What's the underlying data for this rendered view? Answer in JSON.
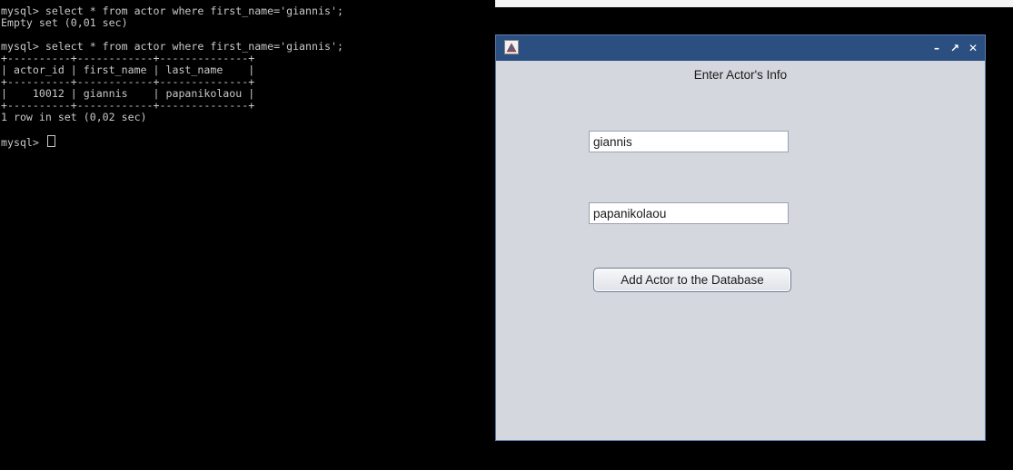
{
  "terminal": {
    "lines": [
      "mysql> select * from actor where first_name='giannis';",
      "Empty set (0,01 sec)",
      "",
      "mysql> select * from actor where first_name='giannis';",
      "+----------+------------+--------------+",
      "| actor_id | first_name | last_name    |",
      "+----------+------------+--------------+",
      "|    10012 | giannis    | papanikolaou |",
      "+----------+------------+--------------+",
      "1 row in set (0,02 sec)",
      ""
    ],
    "prompt": "mysql> "
  },
  "window": {
    "icon": "java-app-icon",
    "controls": {
      "minimize": "–",
      "maximize": "↗",
      "close": "✕"
    },
    "heading": "Enter Actor's Info",
    "first_name_value": "giannis",
    "last_name_value": "papanikolaou",
    "add_button_label": "Add Actor to the Database"
  }
}
